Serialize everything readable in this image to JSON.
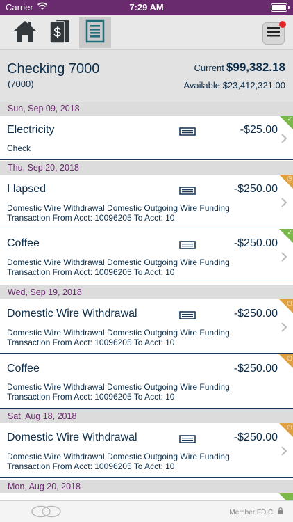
{
  "status_bar": {
    "carrier": "Carrier",
    "time": "7:29 AM"
  },
  "account": {
    "name": "Checking 7000",
    "number": "(7000)",
    "current_label": "Current",
    "current_amount": "$99,382.18",
    "available_label": "Available",
    "available_amount": "$23,412,321.00"
  },
  "groups": [
    {
      "date": "Sun, Sep 09, 2018"
    },
    {
      "date": "Thu, Sep 20, 2018"
    },
    {
      "date": "Wed, Sep 19, 2018"
    },
    {
      "date": "Sat, Aug 18, 2018"
    },
    {
      "date": "Mon, Aug 20, 2018"
    }
  ],
  "transactions": [
    {
      "title": "Electricity",
      "amount": "-$25.00",
      "desc1": "Check",
      "desc2": "",
      "status": "posted"
    },
    {
      "title": "I lapsed",
      "amount": "-$250.00",
      "desc1": "Domestic Wire Withdrawal  Domestic Outgoing Wire Funding",
      "desc2": "Transaction From Acct: 10096205 To Acct: 10",
      "status": "pending"
    },
    {
      "title": "Coffee",
      "amount": "-$250.00",
      "desc1": "Domestic Wire Withdrawal  Domestic Outgoing Wire Funding",
      "desc2": "Transaction From Acct: 10096205 To Acct: 10",
      "status": "posted"
    },
    {
      "title": "Domestic Wire Withdrawal",
      "amount": "-$250.00",
      "desc1": "Domestic Wire Withdrawal  Domestic Outgoing Wire Funding",
      "desc2": "Transaction From Acct: 10096205 To Acct: 10",
      "status": "pending"
    },
    {
      "title": "Coffee",
      "amount": "-$250.00",
      "desc1": "Domestic Wire Withdrawal  Domestic Outgoing Wire Funding",
      "desc2": "Transaction From Acct: 10096205 To Acct: 10",
      "status": "pending"
    },
    {
      "title": "Domestic Wire Withdrawal",
      "amount": "-$250.00",
      "desc1": "Domestic Wire Withdrawal  Domestic Outgoing Wire Funding",
      "desc2": "Transaction From Acct: 10096205 To Acct: 10",
      "status": "pending"
    },
    {
      "title": "",
      "amount": "",
      "desc1": "",
      "desc2": "",
      "status": "posted"
    }
  ],
  "footer": {
    "member_fdic": "Member FDIC"
  },
  "colors": {
    "brand": "#6a2a6e",
    "navy": "#0c2d4a",
    "posted": "#7ab84a",
    "pending": "#e0a040",
    "teal_icon": "#1f6f7a"
  },
  "icons": [
    "wifi-icon",
    "battery-icon",
    "home-icon",
    "money-icon",
    "statement-icon",
    "menu-icon",
    "check-image-icon",
    "chevron-right-icon",
    "lock-icon"
  ]
}
